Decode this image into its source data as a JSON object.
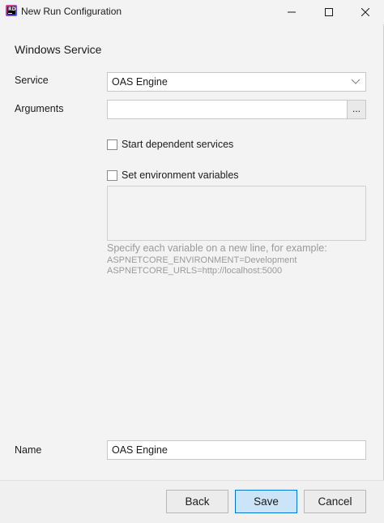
{
  "window": {
    "title": "New Run Configuration",
    "app_icon": "rider-app-icon"
  },
  "controls": {
    "minimize": "minimize-icon",
    "maximize": "maximize-icon",
    "close": "close-icon"
  },
  "form": {
    "section_title": "Windows Service",
    "service": {
      "label": "Service",
      "value": "OAS Engine"
    },
    "arguments": {
      "label": "Arguments",
      "value": "",
      "browse_label": "..."
    },
    "start_dependent": {
      "label": "Start dependent services",
      "checked": false
    },
    "set_env": {
      "label": "Set environment variables",
      "checked": false
    },
    "env_hint": {
      "line1": "Specify each variable on a new line, for example:",
      "line2": "ASPNETCORE_ENVIRONMENT=Development",
      "line3": "ASPNETCORE_URLS=http://localhost:5000"
    },
    "name": {
      "label": "Name",
      "value": "OAS Engine"
    }
  },
  "footer": {
    "back_label": "Back",
    "save_label": "Save",
    "cancel_label": "Cancel"
  },
  "colors": {
    "primary_button_bg": "#cce4f7",
    "primary_button_border": "#0078d4",
    "hint_text": "#9a9a9a"
  }
}
